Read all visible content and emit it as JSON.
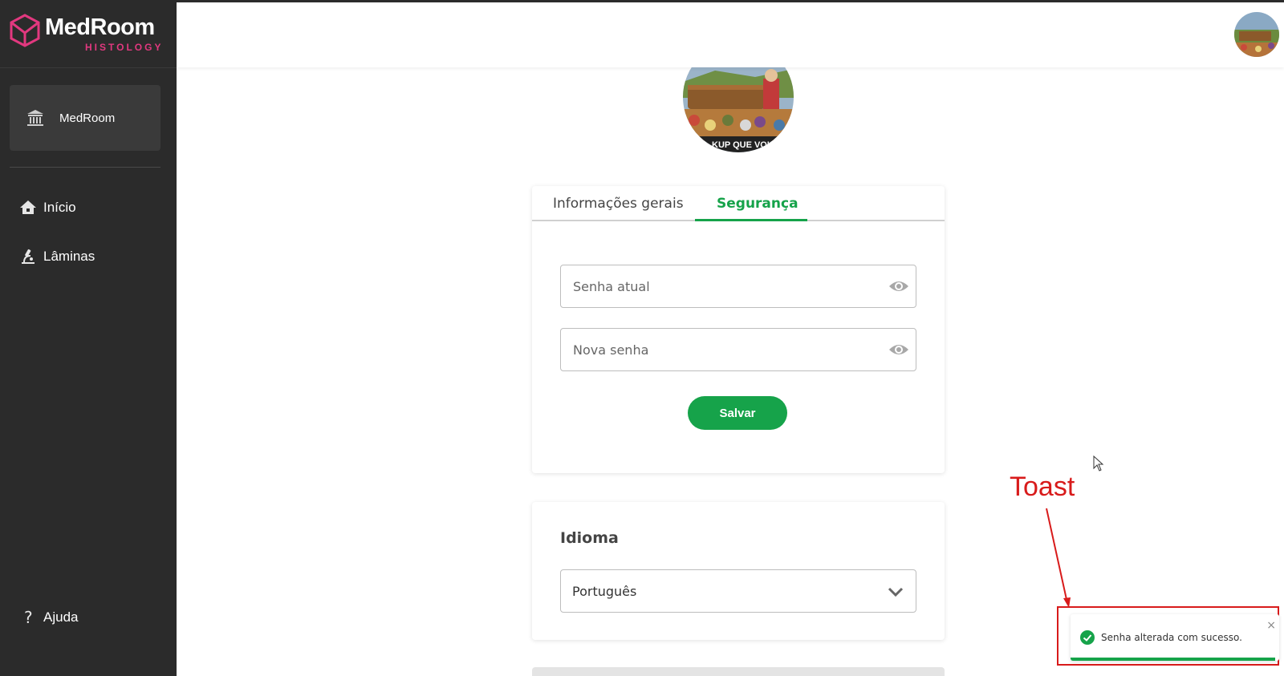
{
  "brand": {
    "name": "MedRoom",
    "subtitle": "HISTOLOGY",
    "accent": "#e2387f"
  },
  "sidebar": {
    "org": {
      "label": "MedRoom",
      "icon": "institution-icon"
    },
    "items": [
      {
        "label": "Início",
        "icon": "home-icon"
      },
      {
        "label": "Lâminas",
        "icon": "microscope-icon"
      }
    ],
    "help": {
      "label": "Ajuda",
      "icon": "question-icon"
    }
  },
  "tabs": {
    "general": "Informações gerais",
    "security": "Segurança",
    "active": "security"
  },
  "security": {
    "current_password_placeholder": "Senha atual",
    "new_password_placeholder": "Nova senha",
    "save_label": "Salvar"
  },
  "language": {
    "title": "Idioma",
    "selected": "Português"
  },
  "annotation": {
    "label": "Toast"
  },
  "toast": {
    "message": "Senha alterada com sucesso.",
    "close": "×",
    "progress": 0.98
  },
  "colors": {
    "primary": "#16a34a",
    "sidebar": "#2b2b2b",
    "annotation": "#d81b1b"
  },
  "avatar_caption": "KUP QUE VOU FE"
}
